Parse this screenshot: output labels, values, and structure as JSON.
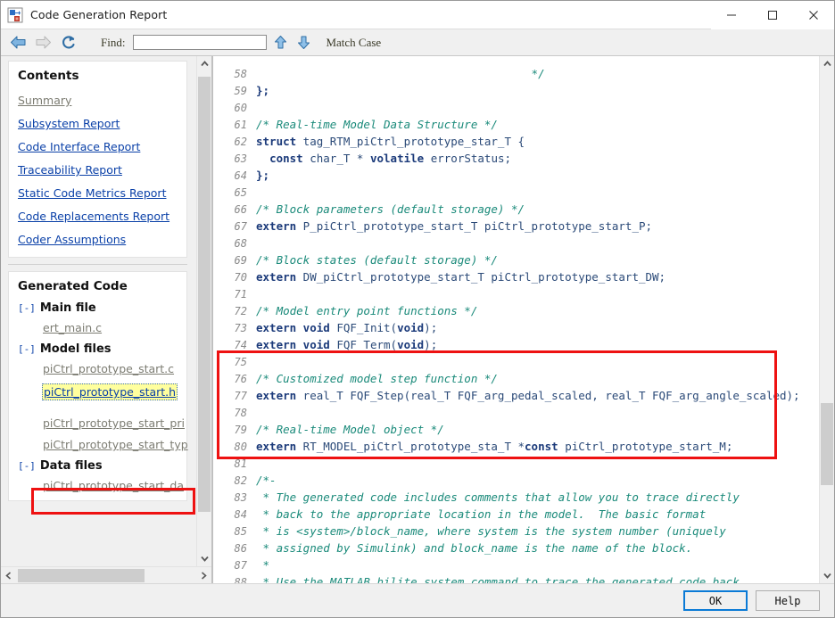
{
  "window": {
    "title": "Code Generation Report",
    "icon": "simulink-report-icon",
    "controls": {
      "minimize": "minimize-icon",
      "maximize": "maximize-icon",
      "close": "close-icon"
    }
  },
  "toolbar": {
    "back_icon": "back-arrow-icon",
    "forward_icon": "forward-arrow-icon",
    "refresh_icon": "refresh-icon",
    "find_label": "Find:",
    "find_value": "",
    "find_placeholder": "",
    "find_prev_icon": "find-up-arrow-icon",
    "find_next_icon": "find-down-arrow-icon",
    "match_case_label": "Match Case"
  },
  "sidebar": {
    "contents": {
      "title": "Contents",
      "links": [
        {
          "label": "Summary",
          "state": "visited"
        },
        {
          "label": "Subsystem Report",
          "state": "normal"
        },
        {
          "label": "Code Interface Report",
          "state": "normal"
        },
        {
          "label": "Traceability Report",
          "state": "normal"
        },
        {
          "label": "Static Code Metrics Report",
          "state": "normal"
        },
        {
          "label": "Code Replacements Report",
          "state": "normal"
        },
        {
          "label": "Coder Assumptions",
          "state": "normal"
        }
      ]
    },
    "generated_code": {
      "title": "Generated Code",
      "groups": [
        {
          "toggle": "[-]",
          "label": "Main file",
          "files": [
            {
              "name": "ert_main.c",
              "state": "visited"
            }
          ]
        },
        {
          "toggle": "[-]",
          "label": "Model files",
          "files": [
            {
              "name": "piCtrl_prototype_start.c",
              "state": "visited"
            },
            {
              "name": "piCtrl_prototype_start.h",
              "state": "current"
            },
            {
              "name": "piCtrl_prototype_start_pri",
              "state": "visited"
            },
            {
              "name": "piCtrl_prototype_start_typ",
              "state": "visited"
            }
          ]
        },
        {
          "toggle": "[-]",
          "label": "Data files",
          "files": [
            {
              "name": "piCtrl_prototype_start_da",
              "state": "visited"
            }
          ]
        }
      ]
    },
    "hscroll": {
      "left_arrow": "chevron-left-icon",
      "right_arrow": "chevron-right-icon"
    },
    "vscroll": {
      "up_arrow": "chevron-up-icon",
      "down_arrow": "chevron-down-icon"
    }
  },
  "code": {
    "vscroll": {
      "up_arrow": "chevron-up-icon",
      "down_arrow": "chevron-down-icon"
    },
    "highlight_box": "red-annotation-box",
    "lines": [
      {
        "n": "",
        "tokens": [
          {
            "t": "",
            "c": ""
          }
        ],
        "partial": true
      },
      {
        "n": "58",
        "tokens": [
          {
            "t": "                                         */",
            "c": "cmt"
          }
        ]
      },
      {
        "n": "59",
        "tokens": [
          {
            "t": "};",
            "c": "kw"
          }
        ]
      },
      {
        "n": "60",
        "tokens": [
          {
            "t": "",
            "c": ""
          }
        ]
      },
      {
        "n": "61",
        "tokens": [
          {
            "t": "/* Real-time Model Data Structure */",
            "c": "cmt"
          }
        ]
      },
      {
        "n": "62",
        "tokens": [
          {
            "t": "struct",
            "c": "kw"
          },
          {
            "t": " tag_RTM_piCtrl_prototype_star_T {",
            "c": "id"
          }
        ]
      },
      {
        "n": "63",
        "tokens": [
          {
            "t": "  ",
            "c": "id"
          },
          {
            "t": "const",
            "c": "kw"
          },
          {
            "t": " char_T * ",
            "c": "id"
          },
          {
            "t": "volatile",
            "c": "kw"
          },
          {
            "t": " errorStatus;",
            "c": "id"
          }
        ]
      },
      {
        "n": "64",
        "tokens": [
          {
            "t": "};",
            "c": "kw"
          }
        ]
      },
      {
        "n": "65",
        "tokens": [
          {
            "t": "",
            "c": ""
          }
        ]
      },
      {
        "n": "66",
        "tokens": [
          {
            "t": "/* Block parameters (default storage) */",
            "c": "cmt"
          }
        ]
      },
      {
        "n": "67",
        "tokens": [
          {
            "t": "extern",
            "c": "kw"
          },
          {
            "t": " P_piCtrl_prototype_start_T piCtrl_prototype_start_P;",
            "c": "id"
          }
        ]
      },
      {
        "n": "68",
        "tokens": [
          {
            "t": "",
            "c": ""
          }
        ]
      },
      {
        "n": "69",
        "tokens": [
          {
            "t": "/* Block states (default storage) */",
            "c": "cmt"
          }
        ]
      },
      {
        "n": "70",
        "tokens": [
          {
            "t": "extern",
            "c": "kw"
          },
          {
            "t": " DW_piCtrl_prototype_start_T piCtrl_prototype_start_DW;",
            "c": "id"
          }
        ]
      },
      {
        "n": "71",
        "tokens": [
          {
            "t": "",
            "c": ""
          }
        ]
      },
      {
        "n": "72",
        "tokens": [
          {
            "t": "/* Model entry point functions */",
            "c": "cmt"
          }
        ]
      },
      {
        "n": "73",
        "tokens": [
          {
            "t": "extern void",
            "c": "kw"
          },
          {
            "t": " FQF_Init(",
            "c": "id"
          },
          {
            "t": "void",
            "c": "kw"
          },
          {
            "t": ");",
            "c": "id"
          }
        ]
      },
      {
        "n": "74",
        "tokens": [
          {
            "t": "extern void",
            "c": "kw"
          },
          {
            "t": " FQF_Term(",
            "c": "id"
          },
          {
            "t": "void",
            "c": "kw"
          },
          {
            "t": ");",
            "c": "id"
          }
        ]
      },
      {
        "n": "75",
        "tokens": [
          {
            "t": "",
            "c": ""
          }
        ]
      },
      {
        "n": "76",
        "tokens": [
          {
            "t": "/* Customized model step function */",
            "c": "cmt"
          }
        ]
      },
      {
        "n": "77",
        "tokens": [
          {
            "t": "extern",
            "c": "kw"
          },
          {
            "t": " real_T FQF_Step(real_T FQF_arg_pedal_scaled, real_T FQF_arg_angle_scaled);",
            "c": "id"
          }
        ]
      },
      {
        "n": "78",
        "tokens": [
          {
            "t": "",
            "c": ""
          }
        ]
      },
      {
        "n": "79",
        "tokens": [
          {
            "t": "/* Real-time Model object */",
            "c": "cmt"
          }
        ]
      },
      {
        "n": "80",
        "tokens": [
          {
            "t": "extern",
            "c": "kw"
          },
          {
            "t": " RT_MODEL_piCtrl_prototype_sta_T *",
            "c": "id"
          },
          {
            "t": "const",
            "c": "kw"
          },
          {
            "t": " piCtrl_prototype_start_M;",
            "c": "id"
          }
        ]
      },
      {
        "n": "81",
        "tokens": [
          {
            "t": "",
            "c": ""
          }
        ]
      },
      {
        "n": "82",
        "tokens": [
          {
            "t": "/*-",
            "c": "cmt"
          }
        ]
      },
      {
        "n": "83",
        "tokens": [
          {
            "t": " * The generated code includes comments that allow you to trace directly",
            "c": "cmt"
          }
        ]
      },
      {
        "n": "84",
        "tokens": [
          {
            "t": " * back to the appropriate location in the model.  The basic format",
            "c": "cmt"
          }
        ]
      },
      {
        "n": "85",
        "tokens": [
          {
            "t": " * is <system>/block_name, where system is the system number (uniquely",
            "c": "cmt"
          }
        ]
      },
      {
        "n": "86",
        "tokens": [
          {
            "t": " * assigned by Simulink) and block_name is the name of the block.",
            "c": "cmt"
          }
        ]
      },
      {
        "n": "87",
        "tokens": [
          {
            "t": " *",
            "c": "cmt"
          }
        ]
      },
      {
        "n": "88",
        "tokens": [
          {
            "t": " * Use the MATLAB hilite_system command to trace the generated code back",
            "c": "cmt"
          }
        ]
      }
    ]
  },
  "footer": {
    "ok_label": "OK",
    "help_label": "Help"
  },
  "colors": {
    "link": "#0b41a8",
    "visited_link": "#7c7c72",
    "comment": "#1a8a7a",
    "keyword": "#1b3a7a",
    "identifier": "#2b4a78",
    "annotation_red": "#ee1111",
    "highlight_yellow": "#ffff9e",
    "focus_blue": "#0a7ad6"
  }
}
